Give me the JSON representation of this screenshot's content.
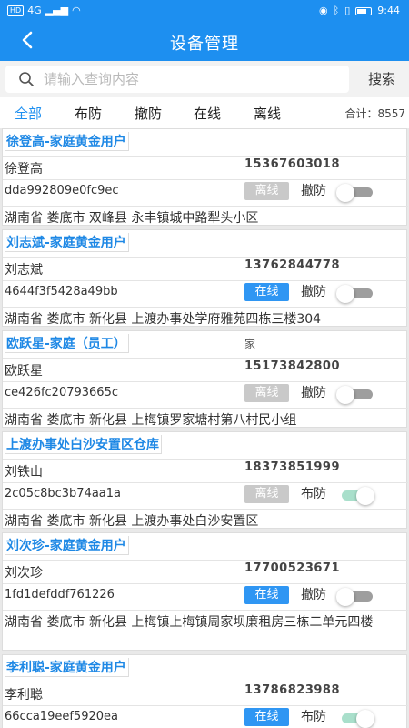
{
  "status_bar": {
    "hd_label": "HD",
    "signal": "4G",
    "time": "9:44"
  },
  "header": {
    "back_icon": "chevron-left-icon",
    "title": "设备管理"
  },
  "search": {
    "placeholder": "请输入查询内容",
    "value": "",
    "button_label": "搜索"
  },
  "tabs": [
    {
      "label": "全部",
      "active": true
    },
    {
      "label": "布防",
      "active": false
    },
    {
      "label": "撤防",
      "active": false
    },
    {
      "label": "在线",
      "active": false
    },
    {
      "label": "离线",
      "active": false
    }
  ],
  "total_text": "合计：8557",
  "colors": {
    "primary": "#1d8ff0",
    "online": "#2f96f3",
    "offline": "#c9c9c9",
    "toggle_on": "#a9dfcb",
    "toggle_off": "#9e9e9e"
  },
  "devices": [
    {
      "title": "徐登高-家庭黄金用户",
      "extra": "",
      "name": "徐登高",
      "phone": "15367603018",
      "device_id": "dda992809e0fc9ec",
      "status": "离线",
      "online": false,
      "mode": "撤防",
      "armed": false,
      "address": "湖南省 娄底市 双峰县 永丰镇城中路犁头小区"
    },
    {
      "title": "刘志斌-家庭黄金用户",
      "extra": "",
      "name": "刘志斌",
      "phone": "13762844778",
      "device_id": "4644f3f5428a49bb",
      "status": "在线",
      "online": true,
      "mode": "撤防",
      "armed": false,
      "address": "湖南省 娄底市 新化县 上渡办事处学府雅苑四栋三楼304"
    },
    {
      "title": "欧跃星-家庭（员工）",
      "extra": "家",
      "name": "欧跃星",
      "phone": "15173842800",
      "device_id": "ce426fc20793665c",
      "status": "离线",
      "online": false,
      "mode": "撤防",
      "armed": false,
      "address": "湖南省 娄底市 新化县 上梅镇罗家塘村第八村民小组"
    },
    {
      "title": "上渡办事处白沙安置区仓库",
      "extra": "",
      "name": "刘铁山",
      "phone": "18373851999",
      "device_id": "2c05c8bc3b74aa1a",
      "status": "离线",
      "online": false,
      "mode": "布防",
      "armed": true,
      "address": "湖南省 娄底市 新化县 上渡办事处白沙安置区"
    },
    {
      "title": "刘次珍-家庭黄金用户",
      "extra": "",
      "name": "刘次珍",
      "phone": "17700523671",
      "device_id": "1fd1defddf761226",
      "status": "在线",
      "online": true,
      "mode": "撤防",
      "armed": false,
      "address": "湖南省 娄底市 新化县 上梅镇上梅镇周家坝廉租房三栋二单元四楼"
    },
    {
      "title": "李利聪-家庭黄金用户",
      "extra": "",
      "name": "李利聪",
      "phone": "13786823988",
      "device_id": "66cca19eef5920ea",
      "status": "在线",
      "online": true,
      "mode": "布防",
      "armed": true,
      "address": ""
    }
  ]
}
